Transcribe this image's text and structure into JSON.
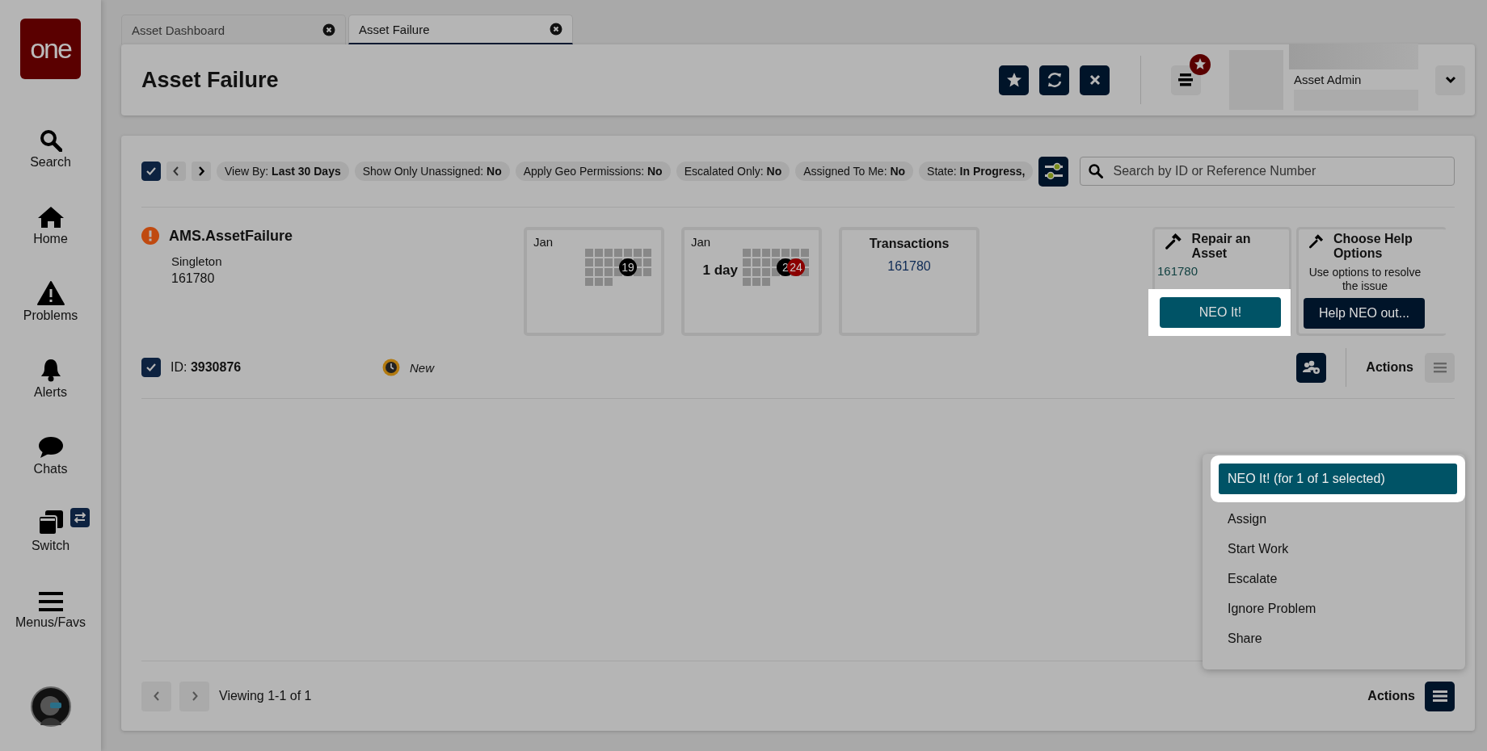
{
  "sidebar": {
    "logo": "one",
    "items": [
      {
        "kind": "search",
        "label": "Search"
      },
      {
        "kind": "home",
        "label": "Home"
      },
      {
        "kind": "problems",
        "label": "Problems"
      },
      {
        "kind": "alerts",
        "label": "Alerts"
      },
      {
        "kind": "chats",
        "label": "Chats"
      },
      {
        "kind": "switch",
        "label": "Switch"
      },
      {
        "kind": "menus",
        "label": "Menus/Favs"
      }
    ]
  },
  "tabs": [
    {
      "label": "Asset Dashboard",
      "selected": false
    },
    {
      "label": "Asset Failure",
      "selected": true
    }
  ],
  "header": {
    "title": "Asset Failure",
    "user": "Asset Admin"
  },
  "filters": {
    "checked": true,
    "chips": [
      "View By: **Last 30 Days**",
      "Show Only Unassigned: **No**",
      "Apply Geo Permissions: **No**",
      "Escalated Only: **No**",
      "Assigned To Me: **No**",
      "State: **In Progress,**"
    ],
    "search_placeholder": "Search by ID or Reference Number"
  },
  "problem": {
    "title": "AMS.AssetFailure",
    "type": "Singleton",
    "ref": "161780",
    "cards": [
      {
        "kind": "calendar",
        "month": "Jan",
        "markers": [
          {
            "label": "19",
            "color": "#000000"
          }
        ]
      },
      {
        "kind": "calendar",
        "month": "Jan",
        "duration": "1 day",
        "markers": [
          {
            "label": "2",
            "color": "#000000"
          },
          {
            "label": "24",
            "color": "#8b0000"
          }
        ]
      },
      {
        "kind": "total",
        "title": "Transactions",
        "value": "161780"
      }
    ],
    "resolutions": [
      {
        "kind": "repair",
        "title": "Repair an Asset",
        "value": "161780",
        "button": "NEO It!",
        "highlighted": true
      },
      {
        "kind": "help",
        "title": "Choose Help Options",
        "text": "Use options to resolve the issue",
        "button": "Help NEO out...",
        "highlighted": false
      }
    ]
  },
  "record": {
    "checked": true,
    "id_label": "ID: **3930876**",
    "status": "New",
    "actions_label": "Actions"
  },
  "menu": {
    "items": [
      {
        "label": "NEO It! (for 1 of 1 selected)",
        "selected": true
      },
      {
        "label": "Assign",
        "selected": false
      },
      {
        "label": "Start Work",
        "selected": false
      },
      {
        "label": "Escalate",
        "selected": false
      },
      {
        "label": "Ignore Problem",
        "selected": false
      },
      {
        "label": "Share",
        "selected": false
      }
    ]
  },
  "footer": {
    "viewing": "Viewing 1-1 of 1",
    "actions_label": "Actions"
  }
}
